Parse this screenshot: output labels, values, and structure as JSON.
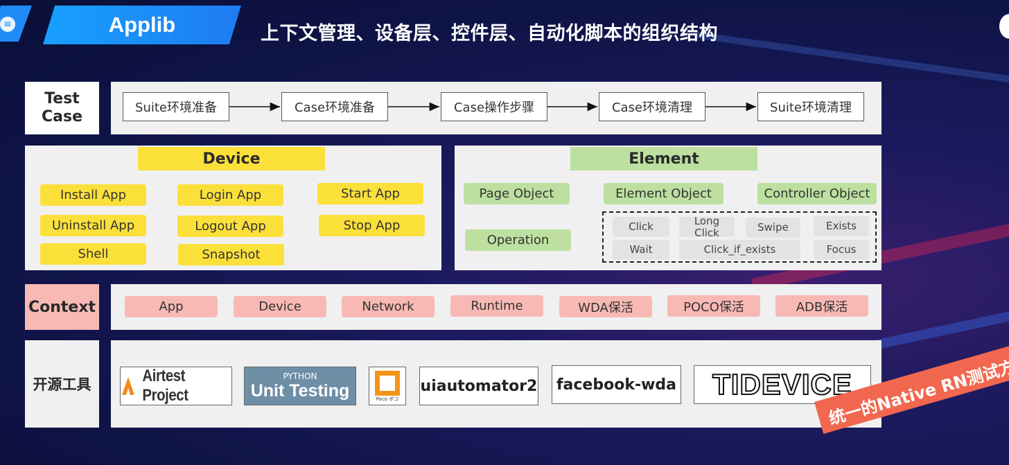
{
  "header": {
    "tab_title": "Applib",
    "heading": "上下文管理、设备层、控件层、自动化脚本的组织结构"
  },
  "test_case": {
    "label": "Test Case",
    "steps": [
      "Suite环境准备",
      "Case环境准备",
      "Case操作步骤",
      "Case环境清理",
      "Suite环境清理"
    ]
  },
  "device": {
    "title": "Device",
    "items": [
      "Install App",
      "Login App",
      "Start App",
      "Uninstall App",
      "Logout App",
      "Stop App",
      "Shell",
      "Snapshot"
    ]
  },
  "element": {
    "title": "Element",
    "objects": [
      "Page Object",
      "Element Object",
      "Controller Object",
      "Operation"
    ],
    "operations": [
      "Click",
      "Long Click",
      "Swipe",
      "Exists",
      "Wait",
      "Click_if_exists",
      "Focus"
    ]
  },
  "context": {
    "label": "Context",
    "items": [
      "App",
      "Device",
      "Network",
      "Runtime",
      "WDA保活",
      "POCO保活",
      "ADB保活"
    ]
  },
  "open_source": {
    "label": "开源工具",
    "tools": [
      "Airtest Project",
      "PYTHON",
      "Unit Testing",
      "Poco ポコ",
      "uiautomator2",
      "facebook-wda",
      "TIDEVICE"
    ]
  },
  "banner": {
    "text": "统一的Native RN测试方案"
  },
  "colors": {
    "device_yellow": "#fce03a",
    "element_green": "#bde0a0",
    "context_pink": "#f8b9b4",
    "title_blue": "#1e7cf0",
    "banner_red": "#f2674f"
  }
}
